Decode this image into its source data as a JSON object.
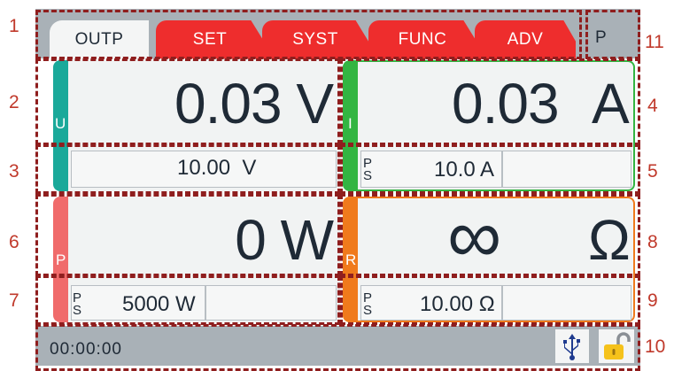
{
  "tabs": [
    {
      "label": "OUTP",
      "active": true
    },
    {
      "label": "SET",
      "active": false
    },
    {
      "label": "SYST",
      "active": false
    },
    {
      "label": "FUNC",
      "active": false
    },
    {
      "label": "ADV",
      "active": false
    }
  ],
  "mode_badge": "P",
  "voltage": {
    "letter": "U",
    "actual": "0.03 V",
    "set": "10.00  V"
  },
  "current": {
    "letter": "I",
    "actual_value": "0.03",
    "actual_unit": "A",
    "ps_p": "P",
    "ps_s": "S",
    "set": "10.0 A"
  },
  "power": {
    "letter": "P",
    "actual": "0 W",
    "ps_p": "P",
    "ps_s": "S",
    "set": "5000 W"
  },
  "resistance": {
    "letter": "R",
    "actual_value": "∞",
    "actual_unit": "Ω",
    "ps_p": "P",
    "ps_s": "S",
    "set": "10.00 Ω"
  },
  "status": {
    "time": "00:00:00"
  },
  "annotations": [
    "1",
    "2",
    "3",
    "4",
    "5",
    "6",
    "7",
    "8",
    "9",
    "10",
    "11"
  ],
  "colors": {
    "tab_red": "#ee2d2d",
    "voltage": "#1aa99a",
    "current": "#33b542",
    "power": "#f06b6b",
    "resistance": "#f07a1c",
    "frame": "#a9b1b7",
    "annotation": "#8f1e1e"
  },
  "icons": [
    "usb-icon",
    "unlocked-padlock-icon"
  ]
}
